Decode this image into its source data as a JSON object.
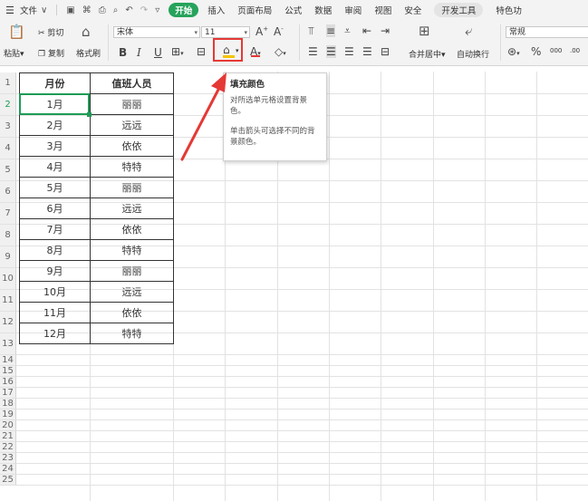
{
  "menubar": {
    "menu_icon": "☰",
    "file_label": "文件",
    "file_arrow": "∨",
    "tabs": [
      {
        "label": "开始",
        "active": true
      },
      {
        "label": "插入"
      },
      {
        "label": "页面布局"
      },
      {
        "label": "公式"
      },
      {
        "label": "数据"
      },
      {
        "label": "审阅"
      },
      {
        "label": "视图"
      },
      {
        "label": "安全"
      },
      {
        "label": "开发工具"
      },
      {
        "label": "特色功"
      }
    ]
  },
  "ribbon": {
    "paste_label": "粘贴",
    "cut_label": "剪切",
    "copy_label": "复制",
    "format_painter_label": "格式刷",
    "font_name": "宋体",
    "font_size": "11",
    "bold": "B",
    "italic": "I",
    "underline": "U",
    "merge_center_label": "合并居中",
    "wrap_label": "自动换行",
    "number_format": "常规",
    "percent": "%",
    "thousands": "000",
    "decimal": ".00"
  },
  "tooltip": {
    "title": "填充颜色",
    "line1": "对所选单元格设置背景色。",
    "line2": "单击箭头可选择不同的背景颜色。"
  },
  "table": {
    "headers": [
      "月份",
      "值班人员"
    ],
    "rows": [
      [
        "1月",
        "丽丽"
      ],
      [
        "2月",
        "远远"
      ],
      [
        "3月",
        "依依"
      ],
      [
        "4月",
        "特特"
      ],
      [
        "5月",
        "丽丽"
      ],
      [
        "6月",
        "远远"
      ],
      [
        "7月",
        "依依"
      ],
      [
        "8月",
        "特特"
      ],
      [
        "9月",
        "丽丽"
      ],
      [
        "10月",
        "远远"
      ],
      [
        "11月",
        "依依"
      ],
      [
        "12月",
        "特特"
      ]
    ]
  },
  "row_numbers": [
    "1",
    "2",
    "3",
    "4",
    "5",
    "6",
    "7",
    "8",
    "9",
    "10",
    "11",
    "12",
    "13",
    "14",
    "15",
    "16",
    "17",
    "18",
    "19",
    "20",
    "21",
    "22",
    "23",
    "24",
    "25"
  ],
  "colors": {
    "accent": "#27a35b",
    "highlight": "#e53935",
    "fill_yellow": "#f6c400"
  }
}
